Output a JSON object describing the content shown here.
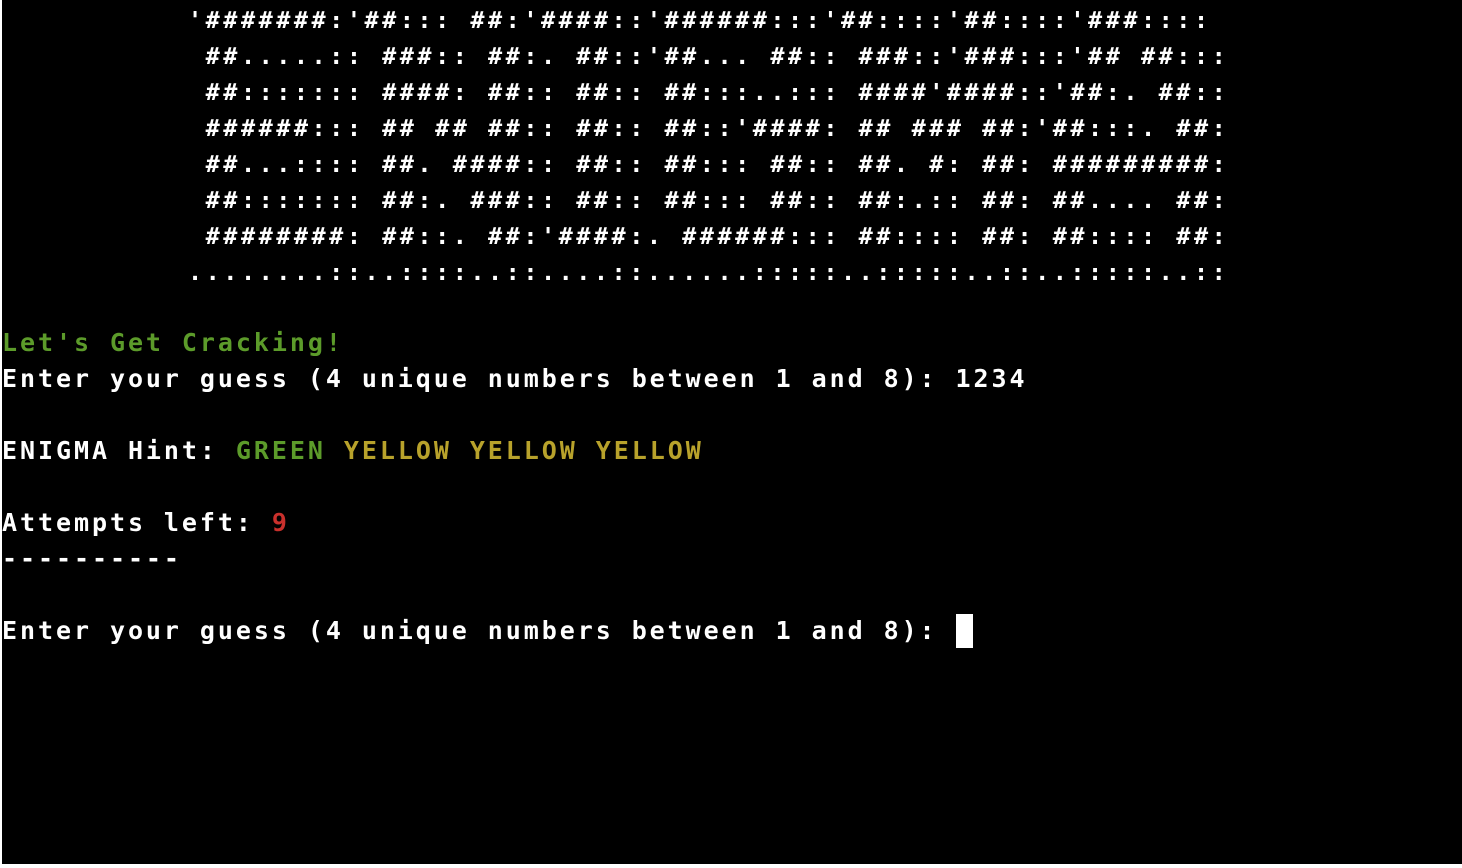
{
  "banner": {
    "lines": [
      "'#######:'##::: ##:'####::'######:::'##::::'##::::'###::::",
      " ##.....:: ###:: ##:. ##::'##... ##:: ###::'###:::'## ##:::",
      " ##::::::: ####: ##:: ##:: ##:::..::: ####'####::'##:. ##::",
      " ######::: ## ## ##:: ##:: ##::'####: ## ### ##:'##:::. ##:",
      " ##...:::: ##. ####:: ##:: ##::: ##:: ##. #: ##: #########:",
      " ##::::::: ##:. ###:: ##:: ##::: ##:: ##:.:: ##: ##.... ##:",
      " ########: ##::. ##:'####:. ######::: ##:::: ##: ##:::: ##:",
      "........::..::::..::....::......:::::..:::::..::..:::::..::"
    ]
  },
  "intro": "Let's Get Cracking!",
  "prompt1": {
    "label": "Enter your guess (4 unique numbers between 1 and 8): ",
    "value": "1234"
  },
  "hint": {
    "label": "ENIGMA Hint: ",
    "words": [
      "GREEN",
      "YELLOW",
      "YELLOW",
      "YELLOW"
    ]
  },
  "attempts": {
    "label": "Attempts left: ",
    "value": "9"
  },
  "divider": "----------",
  "prompt2": {
    "label": "Enter your guess (4 unique numbers between 1 and 8): "
  },
  "colors": {
    "background": "#000000",
    "text": "#ffffff",
    "green": "#5c9b2a",
    "yellow": "#b8a22b",
    "red": "#c9302c"
  }
}
